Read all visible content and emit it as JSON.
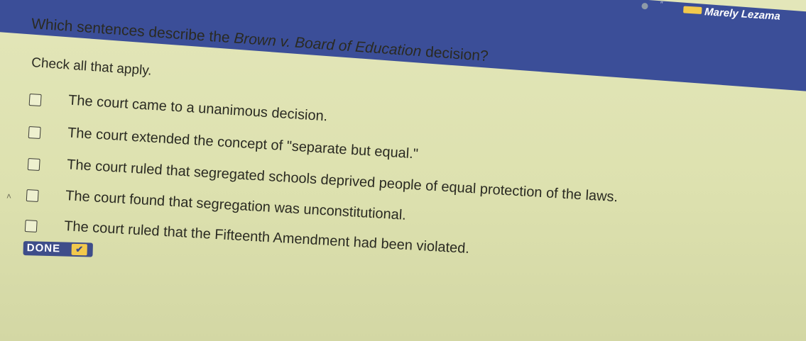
{
  "header": {
    "user_name": "Marely Lezama",
    "glyph": "″",
    "accent_color": "#3b4e98",
    "badge_color": "#f2c94c"
  },
  "question": {
    "prefix": "Which sentences describe the ",
    "case_name": "Brown v. Board of Education",
    "suffix": " decision?",
    "instruction": "Check all that apply."
  },
  "options": [
    {
      "label": "The court came to a unanimous decision.",
      "checked": false
    },
    {
      "label": "The court extended the concept of \"separate but equal.\"",
      "checked": false
    },
    {
      "label": "The court ruled that segregated schools deprived people of equal protection of the laws.",
      "checked": false
    },
    {
      "label": "The court found that segregation was unconstitutional.",
      "checked": false
    },
    {
      "label": "The court ruled that the Fifteenth Amendment had been violated.",
      "checked": false
    }
  ],
  "done_button": {
    "label": "DONE",
    "check_icon": "✔"
  },
  "icons": {
    "status": "status-dot-icon",
    "user": "user-badge-icon",
    "checkbox": "checkbox-icon",
    "done_check": "checkmark-icon"
  }
}
